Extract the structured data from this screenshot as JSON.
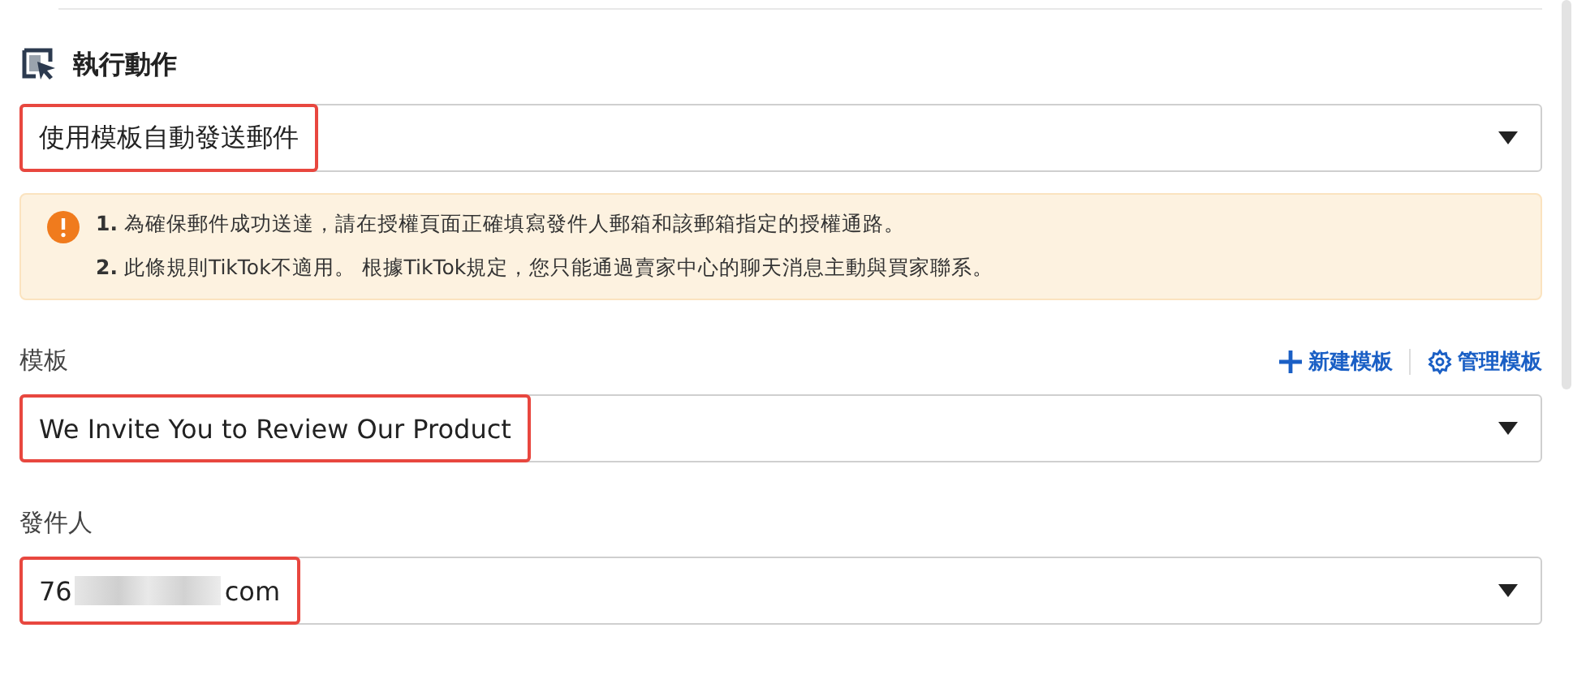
{
  "section": {
    "title": "執行動作"
  },
  "action_select": {
    "value": "使用模板自動發送郵件",
    "highlighted": true
  },
  "notice": {
    "items": [
      {
        "number": "1.",
        "text": "為確保郵件成功送達，請在授權頁面正確填寫發件人郵箱和該郵箱指定的授權通路。"
      },
      {
        "number": "2.",
        "text": "此條規則TikTok不適用。 根據TikTok規定，您只能通過賣家中心的聊天消息主動與買家聯系。"
      }
    ]
  },
  "template": {
    "label": "模板",
    "links": [
      {
        "kind": "add",
        "label": "新建模板"
      },
      {
        "kind": "manage",
        "label": "管理模板"
      }
    ],
    "select": {
      "value": "We Invite You to Review Our Product",
      "highlighted": true
    }
  },
  "sender": {
    "label": "發件人",
    "select": {
      "value_start": "76",
      "redacted": true,
      "value_end": "com",
      "highlighted": true
    }
  }
}
